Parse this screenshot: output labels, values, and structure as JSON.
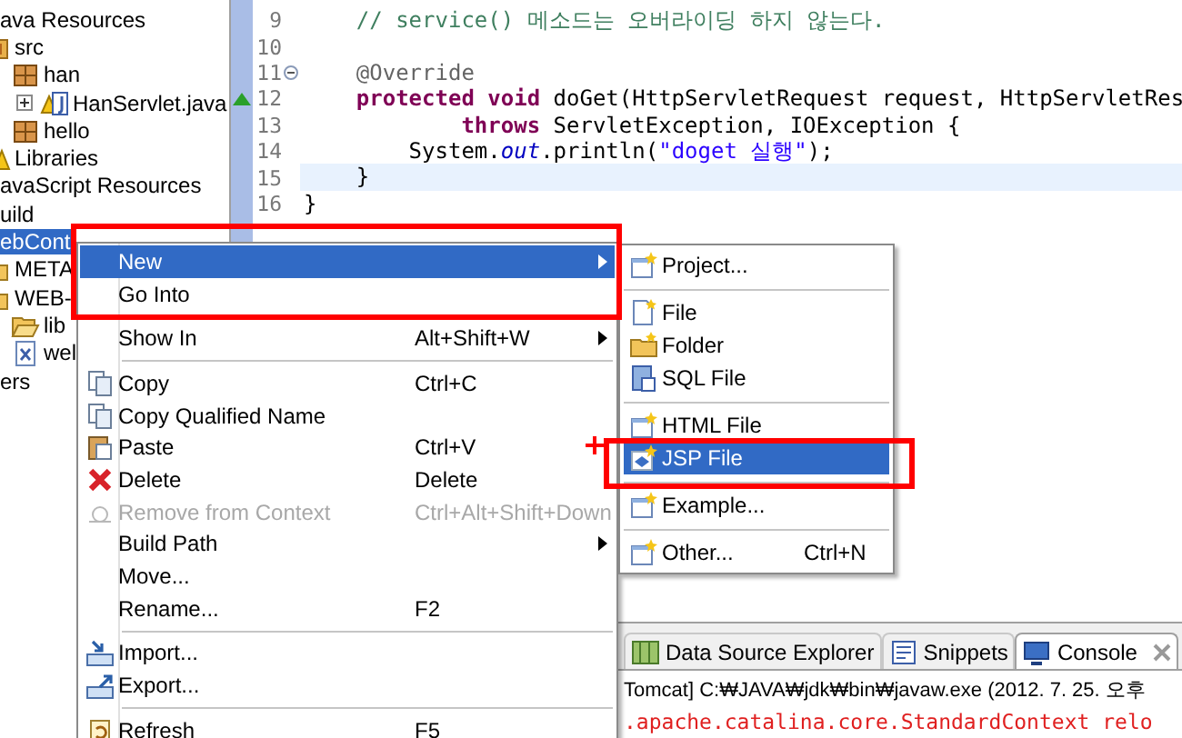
{
  "project_tree": [
    {
      "label": "ava Resources",
      "selected": false,
      "children": [
        {
          "label": "src",
          "kind": "source-folder",
          "selected": false,
          "children": [
            {
              "label": "han",
              "kind": "package",
              "selected": false,
              "children": [
                {
                  "label": "HanServlet.java",
                  "kind": "java-file",
                  "selected": false,
                  "collapsed": true
                }
              ]
            },
            {
              "label": "hello",
              "kind": "package",
              "selected": false
            }
          ]
        },
        {
          "label": "Libraries",
          "kind": "library",
          "selected": false
        }
      ]
    },
    {
      "label": "avaScript Resources",
      "selected": false
    },
    {
      "label": "uild",
      "selected": false
    },
    {
      "label": "ebCont",
      "selected": true,
      "children": [
        {
          "label": "META",
          "kind": "folder",
          "selected": false
        },
        {
          "label": "WEB-",
          "kind": "folder",
          "selected": false,
          "children": [
            {
              "label": "lib",
              "kind": "open-folder",
              "selected": false
            },
            {
              "label": "wel",
              "kind": "xml-file",
              "selected": false
            }
          ]
        }
      ]
    },
    {
      "label": "ers",
      "selected": false
    }
  ],
  "editor": {
    "lines": [
      {
        "number": "9",
        "current": false,
        "segments": [
          {
            "text": "    // service() 메소드는 오버라이딩 하지 않는다.",
            "kind": "comment"
          }
        ]
      },
      {
        "number": "10",
        "current": false
      },
      {
        "number": "11",
        "current": false,
        "fold": true,
        "segments": [
          {
            "text": "    @Override",
            "kind": "annotation"
          }
        ]
      },
      {
        "number": "12",
        "current": false,
        "override_marker": true,
        "segments": [
          {
            "text": "    protected void",
            "kind": "keyword"
          },
          {
            "text": " doGet(HttpServletRequest request, HttpServletRes",
            "kind": "plain"
          }
        ]
      },
      {
        "number": "13",
        "current": false,
        "segments": [
          {
            "text": "            throws",
            "kind": "keyword"
          },
          {
            "text": " ServletException, IOException {",
            "kind": "plain"
          }
        ]
      },
      {
        "number": "14",
        "current": false,
        "segments": [
          {
            "text": "        System.",
            "kind": "plain"
          },
          {
            "text": "out",
            "kind": "field"
          },
          {
            "text": ".println(",
            "kind": "plain"
          },
          {
            "text": "\"doget 실행\"",
            "kind": "string"
          },
          {
            "text": ");",
            "kind": "plain"
          }
        ]
      },
      {
        "number": "15",
        "current": true,
        "segments": [
          {
            "text": "    }",
            "kind": "plain"
          }
        ]
      },
      {
        "number": "16",
        "current": false,
        "segments": [
          {
            "text": "}",
            "kind": "plain"
          }
        ]
      }
    ]
  },
  "context_menu": {
    "items": [
      {
        "kind": "item",
        "label": "New",
        "has_submenu": true,
        "selected": true,
        "disabled": false
      },
      {
        "kind": "item",
        "label": "Go Into",
        "has_submenu": false,
        "selected": false,
        "disabled": false
      },
      {
        "kind": "separator"
      },
      {
        "kind": "item",
        "label": "Show In",
        "shortcut": "Alt+Shift+W",
        "has_submenu": true,
        "selected": false,
        "disabled": false
      },
      {
        "kind": "separator"
      },
      {
        "kind": "item",
        "label": "Copy",
        "shortcut": "Ctrl+C",
        "has_submenu": false,
        "selected": false,
        "disabled": false
      },
      {
        "kind": "item",
        "label": "Copy Qualified Name",
        "has_submenu": false,
        "selected": false,
        "disabled": false
      },
      {
        "kind": "item",
        "label": "Paste",
        "shortcut": "Ctrl+V",
        "has_submenu": false,
        "selected": false,
        "disabled": false
      },
      {
        "kind": "item",
        "label": "Delete",
        "shortcut": "Delete",
        "has_submenu": false,
        "selected": false,
        "disabled": false
      },
      {
        "kind": "item",
        "label": "Remove from Context",
        "shortcut": "Ctrl+Alt+Shift+Down",
        "has_submenu": false,
        "selected": false,
        "disabled": true
      },
      {
        "kind": "item",
        "label": "Build Path",
        "has_submenu": true,
        "selected": false,
        "disabled": false
      },
      {
        "kind": "item",
        "label": "Move...",
        "has_submenu": false,
        "selected": false,
        "disabled": false
      },
      {
        "kind": "item",
        "label": "Rename...",
        "shortcut": "F2",
        "has_submenu": false,
        "selected": false,
        "disabled": false
      },
      {
        "kind": "separator"
      },
      {
        "kind": "item",
        "label": "Import...",
        "has_submenu": false,
        "selected": false,
        "disabled": false
      },
      {
        "kind": "item",
        "label": "Export...",
        "has_submenu": false,
        "selected": false,
        "disabled": false
      },
      {
        "kind": "separator"
      },
      {
        "kind": "item",
        "label": "Refresh",
        "shortcut": "F5",
        "has_submenu": false,
        "selected": false,
        "disabled": false
      }
    ]
  },
  "submenu": {
    "items": [
      {
        "kind": "item",
        "label": "Project...",
        "selected": false
      },
      {
        "kind": "separator"
      },
      {
        "kind": "item",
        "label": "File",
        "selected": false
      },
      {
        "kind": "item",
        "label": "Folder",
        "selected": false
      },
      {
        "kind": "item",
        "label": "SQL File",
        "selected": false
      },
      {
        "kind": "separator"
      },
      {
        "kind": "item",
        "label": "HTML File",
        "selected": false
      },
      {
        "kind": "item",
        "label": "JSP File",
        "selected": true
      },
      {
        "kind": "separator"
      },
      {
        "kind": "item",
        "label": "Example...",
        "selected": false
      },
      {
        "kind": "separator"
      },
      {
        "kind": "item",
        "label": "Other...",
        "shortcut": "Ctrl+N",
        "selected": false
      }
    ]
  },
  "console": {
    "tabs": [
      {
        "label": "Data Source Explorer",
        "selected": false,
        "closable": false
      },
      {
        "label": "Snippets",
        "selected": false,
        "closable": false
      },
      {
        "label": "Console",
        "selected": true,
        "closable": true
      }
    ],
    "lines": [
      {
        "text": "Tomcat] C:₩JAVA₩jdk₩bin₩javaw.exe (2012. 7. 25. 오후",
        "kind": "info"
      },
      {
        "text": ".apache.catalina.core.StandardContext relo",
        "kind": "error"
      }
    ]
  }
}
